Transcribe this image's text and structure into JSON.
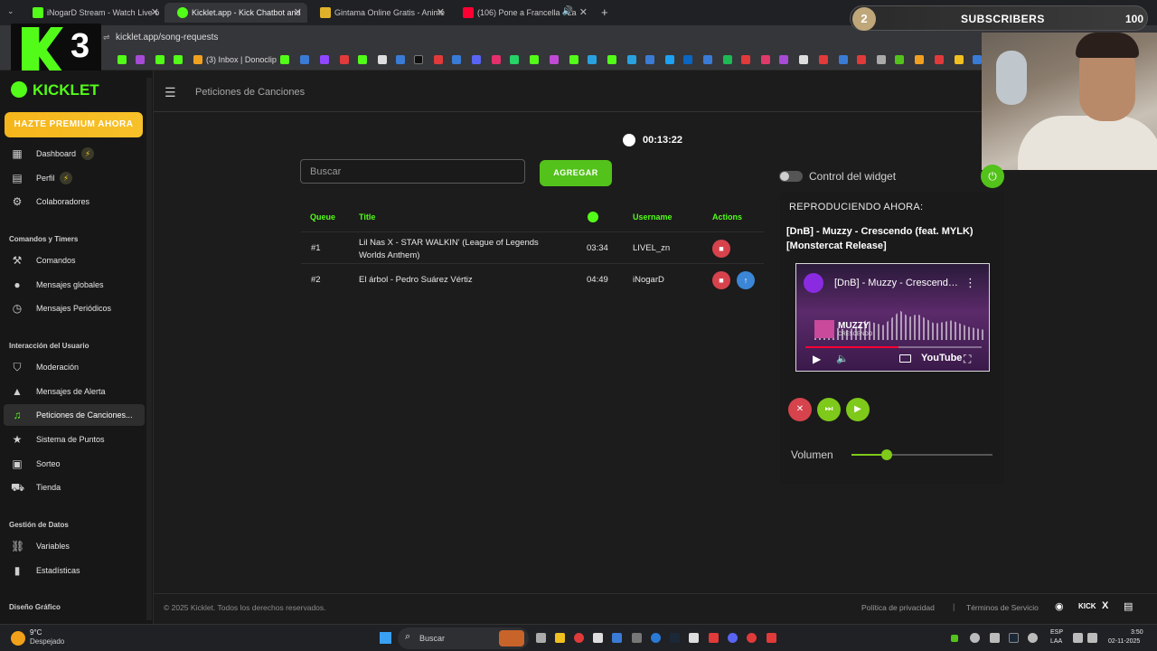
{
  "browser": {
    "tabs": [
      {
        "label": "iNogarD Stream - Watch Live o",
        "favicon_color": "#53fc18"
      },
      {
        "label": "Kicklet.app - Kick Chatbot and",
        "favicon_color": "#53fc18"
      },
      {
        "label": "Gintama Online Gratis - Anime",
        "favicon_color": "#e0b22a"
      },
      {
        "label": "(106) Pone a Francella - La",
        "favicon_color": "#ff0033"
      }
    ],
    "url": "kicklet.app/song-requests",
    "bookmark_label": "(3) Inbox | Donoclip"
  },
  "overlay": {
    "k3_number": "3",
    "subs_count": "2",
    "subs_label": "SUBSCRIBERS",
    "subs_goal": "100"
  },
  "sidebar": {
    "brand": "KICKLET",
    "premium": "HAZTE PREMIUM AHORA",
    "sections": {
      "commands": "Comandos y Timers",
      "interaction": "Interacción del Usuario",
      "data": "Gestión de Datos",
      "design": "Diseño Gráfico"
    },
    "items": {
      "dashboard": "Dashboard",
      "perfil": "Perfil",
      "colaboradores": "Colaboradores",
      "comandos": "Comandos",
      "mensajes_globales": "Mensajes globales",
      "mensajes_periodicos": "Mensajes Periódicos",
      "moderacion": "Moderación",
      "mensajes_alerta": "Mensajes de Alerta",
      "peticiones": "Peticiones de Canciones...",
      "puntos": "Sistema de Puntos",
      "sorteo": "Sorteo",
      "tienda": "Tienda",
      "variables": "Variables",
      "estadisticas": "Estadísticas"
    }
  },
  "header": {
    "title": "Peticiones de Canciones"
  },
  "main": {
    "timer": "00:13:22",
    "search_placeholder": "Buscar",
    "add_label": "AGREGAR",
    "columns": {
      "queue": "Queue",
      "title": "Title",
      "username": "Username",
      "actions": "Actions"
    },
    "rows": [
      {
        "queue": "#1",
        "title": "Lil Nas X - STAR WALKIN' (League of Legends Worlds Anthem)",
        "duration": "03:34",
        "username": "LIVEL_zn"
      },
      {
        "queue": "#2",
        "title": "El árbol - Pedro Suárez Vértiz",
        "duration": "04:49",
        "username": "iNogarD"
      }
    ]
  },
  "player": {
    "widget_label": "Control del widget",
    "now_playing_label": "REPRODUCIENDO AHORA:",
    "now_playing_title": "[DnB] - Muzzy - Crescendo (feat. MYLK) [Monstercat Release]",
    "video": {
      "title": "[DnB] - Muzzy - Crescendo (feat. MYLK)",
      "artist": "MUZZY",
      "song": "CRESCENDO",
      "logo": "YouTube",
      "progress": 0.53
    },
    "volume_label": "Volumen",
    "volume": 0.25
  },
  "footer": {
    "copyright": "© 2025 Kicklet. Todos los derechos reservados.",
    "privacy": "Política de privacidad",
    "separator": "|",
    "terms": "Términos de Servicio",
    "kick": "KICK",
    "x": "X"
  },
  "taskbar": {
    "temp": "9°C",
    "weather": "Despejado",
    "search": "Buscar",
    "lang1": "ESP",
    "lang2": "LAA",
    "time": "3:50",
    "date": "02-11-2025"
  },
  "colors": {
    "accent": "#53fc18",
    "premium": "#f5b61b",
    "delete": "#d6434c",
    "move_up": "#3b86d6"
  }
}
